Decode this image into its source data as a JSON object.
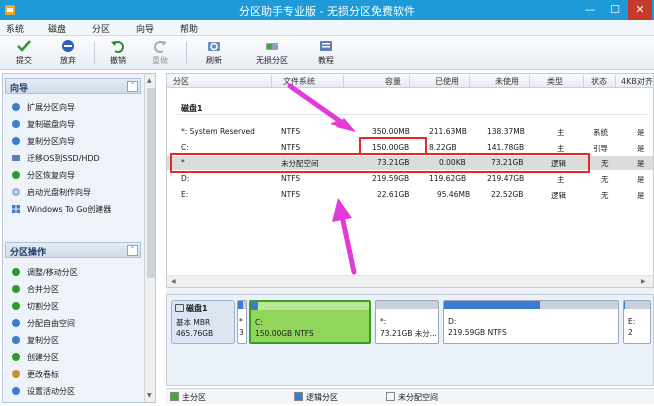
{
  "window": {
    "title": "分区助手专业版 - 无损分区免费软件",
    "minimize": "—",
    "maximize": "☐",
    "close": "✕"
  },
  "menu": [
    "系统",
    "磁盘",
    "分区",
    "向导",
    "帮助"
  ],
  "toolbar": [
    {
      "label": "提交",
      "icon": "check-icon"
    },
    {
      "label": "放弃",
      "icon": "discard-icon"
    },
    {
      "label": "撤销",
      "icon": "undo-icon"
    },
    {
      "label": "重做",
      "icon": "redo-icon"
    },
    {
      "label": "刷新",
      "icon": "refresh-icon"
    },
    {
      "label": "无损分区",
      "icon": "partition-icon"
    },
    {
      "label": "教程",
      "icon": "tutorial-icon"
    }
  ],
  "sidebar": {
    "wizard": {
      "title": "向导",
      "items": [
        "扩展分区向导",
        "复制磁盘向导",
        "复制分区向导",
        "迁移OS到SSD/HDD",
        "分区恢复向导",
        "启动光盘制作向导",
        "Windows To Go创建器"
      ]
    },
    "ops": {
      "title": "分区操作",
      "items": [
        "调整/移动分区",
        "合并分区",
        "切割分区",
        "分配自由空间",
        "复制分区",
        "创建分区",
        "更改卷标",
        "设置活动分区"
      ]
    }
  },
  "table": {
    "headers": [
      "分区",
      "文件系统",
      "容量",
      "已使用",
      "未使用",
      "类型",
      "状态",
      "4KB对齐"
    ],
    "disk_title": "磁盘1",
    "rows": [
      [
        "*: System Reserved",
        "NTFS",
        "350.00MB",
        "211.63MB",
        "138.37MB",
        "主",
        "系统",
        "是"
      ],
      [
        "C:",
        "NTFS",
        "150.00GB",
        "8.22GB",
        "141.78GB",
        "主",
        "引导",
        "是"
      ],
      [
        "*",
        "未分配空间",
        "73.21GB",
        "0.00KB",
        "73.21GB",
        "逻辑",
        "无",
        "是"
      ],
      [
        "D:",
        "NTFS",
        "219.59GB",
        "119.62GB",
        "219.47GB",
        "主",
        "无",
        "是"
      ],
      [
        "E:",
        "NTFS",
        "22.61GB",
        "95.46MB",
        "22.52GB",
        "逻辑",
        "无",
        "是"
      ]
    ]
  },
  "diskmap": {
    "disk_name": "磁盘1",
    "disk_type": "基本 MBR",
    "disk_size": "465.76GB",
    "segments": [
      {
        "name": "*",
        "line2": "3",
        "used": 0.6
      },
      {
        "name": "C:",
        "line2": "150.00GB NTFS",
        "used": 0.06
      },
      {
        "name": "*:",
        "line2": "73.21GB 未分...",
        "used": 0.0
      },
      {
        "name": "D:",
        "line2": "219.59GB NTFS",
        "used": 0.55
      },
      {
        "name": "E:",
        "line2": "2",
        "used": 0.05
      }
    ]
  },
  "legend": [
    "主分区",
    "逻辑分区",
    "未分配空间"
  ],
  "colors": {
    "titlebar": "#1e9ad8",
    "highlight": "#e8262b",
    "arrow": "#e23ad8",
    "primary": "#4aa63a",
    "logical": "#3b7bd0"
  }
}
